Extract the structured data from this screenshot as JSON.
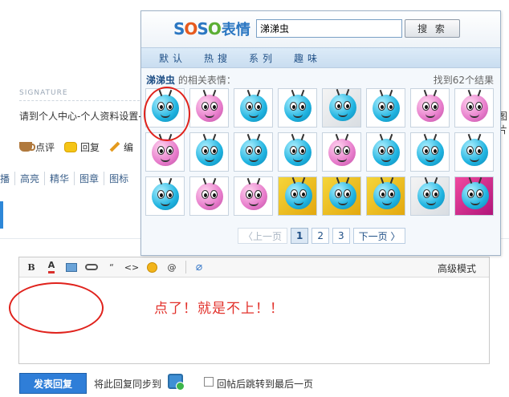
{
  "page": {
    "signature_label": "SIGNATURE",
    "signature_text": "请到个人中心-个人资料设置-",
    "edge_text": "图片",
    "actions": [
      "点评",
      "回复",
      "编"
    ],
    "toolbar2": [
      "播",
      "高亮",
      "精华",
      "图章",
      "图标"
    ]
  },
  "editor": {
    "advanced_mode": "高级模式",
    "note": "点了！就是不上！！",
    "toolbar_icons": [
      "bold-icon",
      "font-color-icon",
      "image-icon",
      "link-icon",
      "quote-icon",
      "code-icon",
      "smiley-icon",
      "at-icon",
      "attachment-icon"
    ],
    "tool_labels": {
      "bold": "B",
      "color": "A",
      "quote": "“",
      "code": "<>",
      "at": "@"
    }
  },
  "footer": {
    "submit": "发表回复",
    "sync": "将此回复同步到",
    "jump": "回帖后跳转到最后一页"
  },
  "popup": {
    "logo": {
      "s1": "S",
      "o1": "O",
      "s2": "S",
      "o2": "O",
      "suffix": "表情"
    },
    "search_value": "涕涕虫",
    "search_button": "搜 索",
    "tabs": [
      "默认",
      "热搜",
      "系列",
      "趣味"
    ],
    "related_keyword": "涕涕虫",
    "related_suffix": " 的相关表情：",
    "found": "找到62个结果",
    "emoticons": [
      {
        "style": "cyan",
        "kind": "face"
      },
      {
        "style": "pink",
        "kind": "face"
      },
      {
        "style": "cyan",
        "kind": "face"
      },
      {
        "style": "cyan",
        "kind": "face"
      },
      {
        "style": "white",
        "kind": "cartoon"
      },
      {
        "style": "cyan",
        "kind": "face"
      },
      {
        "style": "pink",
        "kind": "face"
      },
      {
        "style": "pink",
        "kind": "face"
      },
      {
        "style": "pink",
        "kind": "face"
      },
      {
        "style": "cyan",
        "kind": "face"
      },
      {
        "style": "cyan",
        "kind": "face"
      },
      {
        "style": "cyan",
        "kind": "face"
      },
      {
        "style": "pink",
        "kind": "face"
      },
      {
        "style": "cyan",
        "kind": "face"
      },
      {
        "style": "cyan",
        "kind": "face"
      },
      {
        "style": "cyan",
        "kind": "face"
      },
      {
        "style": "cyan",
        "kind": "face"
      },
      {
        "style": "pink",
        "kind": "face"
      },
      {
        "style": "pink",
        "kind": "face"
      },
      {
        "style": "yellow",
        "kind": "cartoon"
      },
      {
        "style": "yellow",
        "kind": "cartoon"
      },
      {
        "style": "yellow",
        "kind": "cartoon"
      },
      {
        "style": "white",
        "kind": "cartoon"
      },
      {
        "style": "pinkbg",
        "kind": "cartoon"
      }
    ],
    "pager": {
      "prev": "〈上一页",
      "pages": [
        "1",
        "2",
        "3"
      ],
      "current": "1",
      "next": "下一页 〉"
    }
  },
  "colors": {
    "annotation_red": "#e0221c",
    "link_blue": "#1f4f86",
    "submit_blue": "#2f7ed8"
  }
}
